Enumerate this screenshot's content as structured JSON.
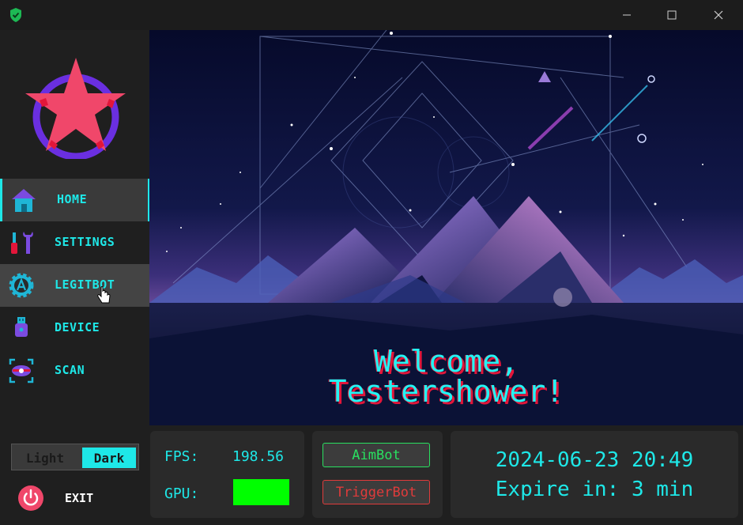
{
  "window": {
    "minimize_glyph": "—",
    "maximize_glyph": "☐",
    "close_glyph": "✕"
  },
  "sidebar": {
    "items": [
      {
        "label": "HOME",
        "icon": "home-icon",
        "state": "active"
      },
      {
        "label": "SETTINGS",
        "icon": "wrench-screwdriver-icon",
        "state": "normal"
      },
      {
        "label": "LEGITBOT",
        "icon": "gear-a-icon",
        "state": "hover"
      },
      {
        "label": "DEVICE",
        "icon": "usb-device-icon",
        "state": "normal"
      },
      {
        "label": "SCAN",
        "icon": "scan-eye-icon",
        "state": "normal"
      }
    ],
    "theme": {
      "light_label": "Light",
      "dark_label": "Dark",
      "selected": "Dark"
    },
    "exit_label": "EXIT"
  },
  "hero": {
    "welcome_line1": "Welcome,",
    "welcome_line2": "Testershower!"
  },
  "stats": {
    "fps_label": "FPS:",
    "fps_value": "198.56",
    "gpu_label": "GPU:",
    "gpu_color": "#00ff00"
  },
  "toggles": {
    "aimbot_label": "AimBot",
    "aimbot_color": "#29e060",
    "triggerbot_label": "TriggerBot",
    "triggerbot_color": "#e03b3b"
  },
  "status": {
    "datetime": "2024-06-23 20:49",
    "expire": "Expire in: 3 min"
  },
  "colors": {
    "accent": "#1ee8e8",
    "background": "#1f1f1f",
    "panel": "#2a2a2a"
  }
}
